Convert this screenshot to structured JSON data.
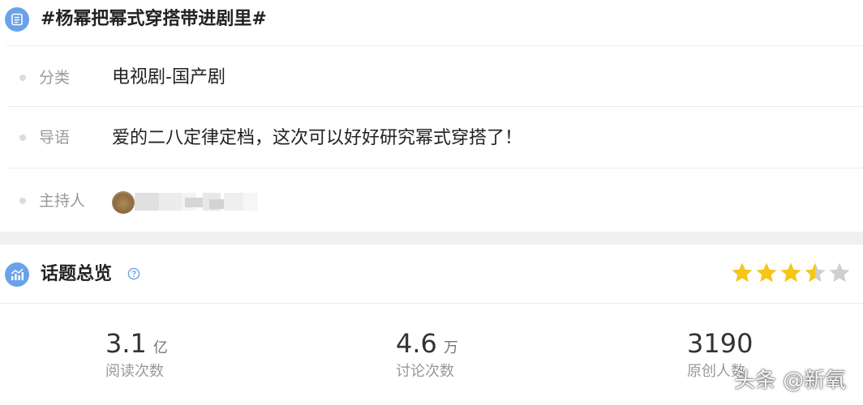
{
  "topic": {
    "title": "#杨幂把幂式穿搭带进剧里#",
    "icon": "list-doc-icon"
  },
  "info_rows": [
    {
      "label": "分类",
      "value": "电视剧-国产剧"
    },
    {
      "label": "导语",
      "value": "爱的二八定律定档，这次可以好好研究幂式穿搭了！"
    },
    {
      "label": "主持人",
      "value": ""
    }
  ],
  "overview": {
    "title": "话题总览",
    "icon": "chart-icon",
    "help_icon": "question-circle-icon",
    "rating": 3.5,
    "rating_max": 5,
    "star_color": "#f5c518",
    "star_empty_color": "#cfcfcf"
  },
  "stats": [
    {
      "value": "3.1",
      "unit": "亿",
      "label": "阅读次数"
    },
    {
      "value": "4.6",
      "unit": "万",
      "label": "讨论次数"
    },
    {
      "value": "3190",
      "unit": "",
      "label": "原创人数"
    }
  ],
  "watermark": "头条 @新氧",
  "colors": {
    "accent": "#6aa2e8",
    "divider": "#ececec",
    "band": "#f0f0f0"
  }
}
